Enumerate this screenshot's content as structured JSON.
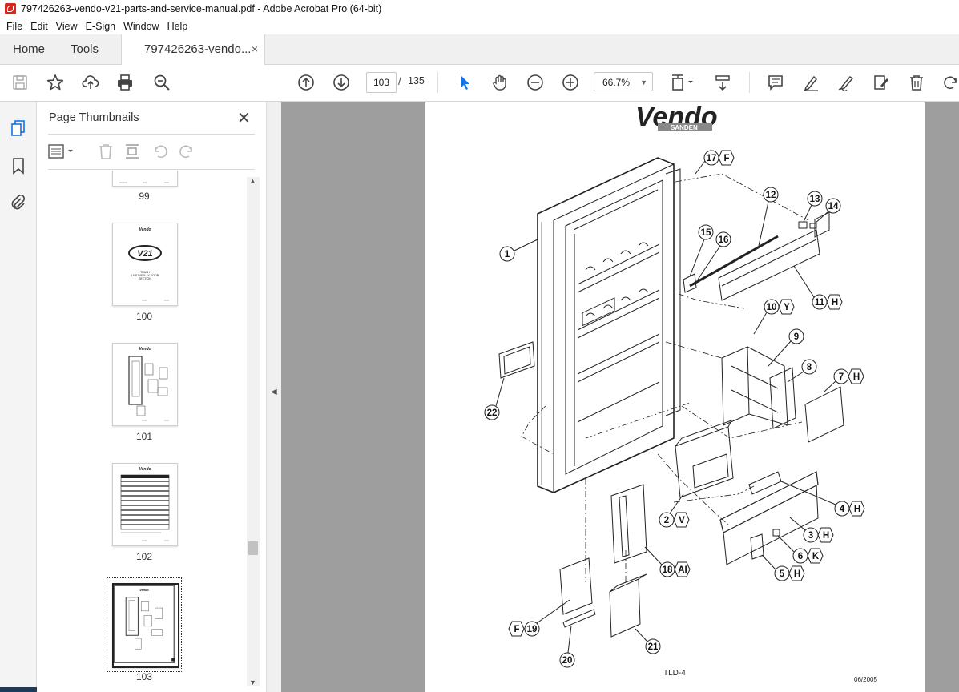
{
  "window": {
    "title": "797426263-vendo-v21-parts-and-service-manual.pdf - Adobe Acrobat Pro (64-bit)"
  },
  "menu": [
    "File",
    "Edit",
    "View",
    "E-Sign",
    "Window",
    "Help"
  ],
  "tabs": {
    "home": "Home",
    "tools": "Tools",
    "document": "797426263-vendo...",
    "close": "×"
  },
  "toolbar": {
    "current_page": "103",
    "separator": "/",
    "total_pages": "135",
    "zoom": "66.7%"
  },
  "panel": {
    "title": "Page Thumbnails",
    "close": "✕",
    "thumbnails": [
      {
        "label": "99"
      },
      {
        "label": "100",
        "heading": "V21",
        "lines": [
          "TRASH",
          "LIVE DISPLAY DOOR",
          "SECTION"
        ]
      },
      {
        "label": "101"
      },
      {
        "label": "102"
      },
      {
        "label": "103",
        "selected": true
      }
    ]
  },
  "document": {
    "logo": "Vendo",
    "logo_sub": "SANDEN",
    "footer_code": "TLD-4",
    "footer_date": "06/2005",
    "callouts": [
      {
        "num": "1"
      },
      {
        "num": "2",
        "code": "V"
      },
      {
        "num": "3",
        "code": "H"
      },
      {
        "num": "4",
        "code": "H"
      },
      {
        "num": "5",
        "code": "H"
      },
      {
        "num": "6",
        "code": "K"
      },
      {
        "num": "7",
        "code": "H"
      },
      {
        "num": "8"
      },
      {
        "num": "9"
      },
      {
        "num": "10",
        "code": "Y"
      },
      {
        "num": "11",
        "code": "H"
      },
      {
        "num": "12"
      },
      {
        "num": "13"
      },
      {
        "num": "14"
      },
      {
        "num": "15"
      },
      {
        "num": "16"
      },
      {
        "num": "17",
        "code": "F"
      },
      {
        "num": "18",
        "code": "AI"
      },
      {
        "num": "19",
        "code": "F"
      },
      {
        "num": "20"
      },
      {
        "num": "21"
      },
      {
        "num": "22"
      }
    ]
  }
}
